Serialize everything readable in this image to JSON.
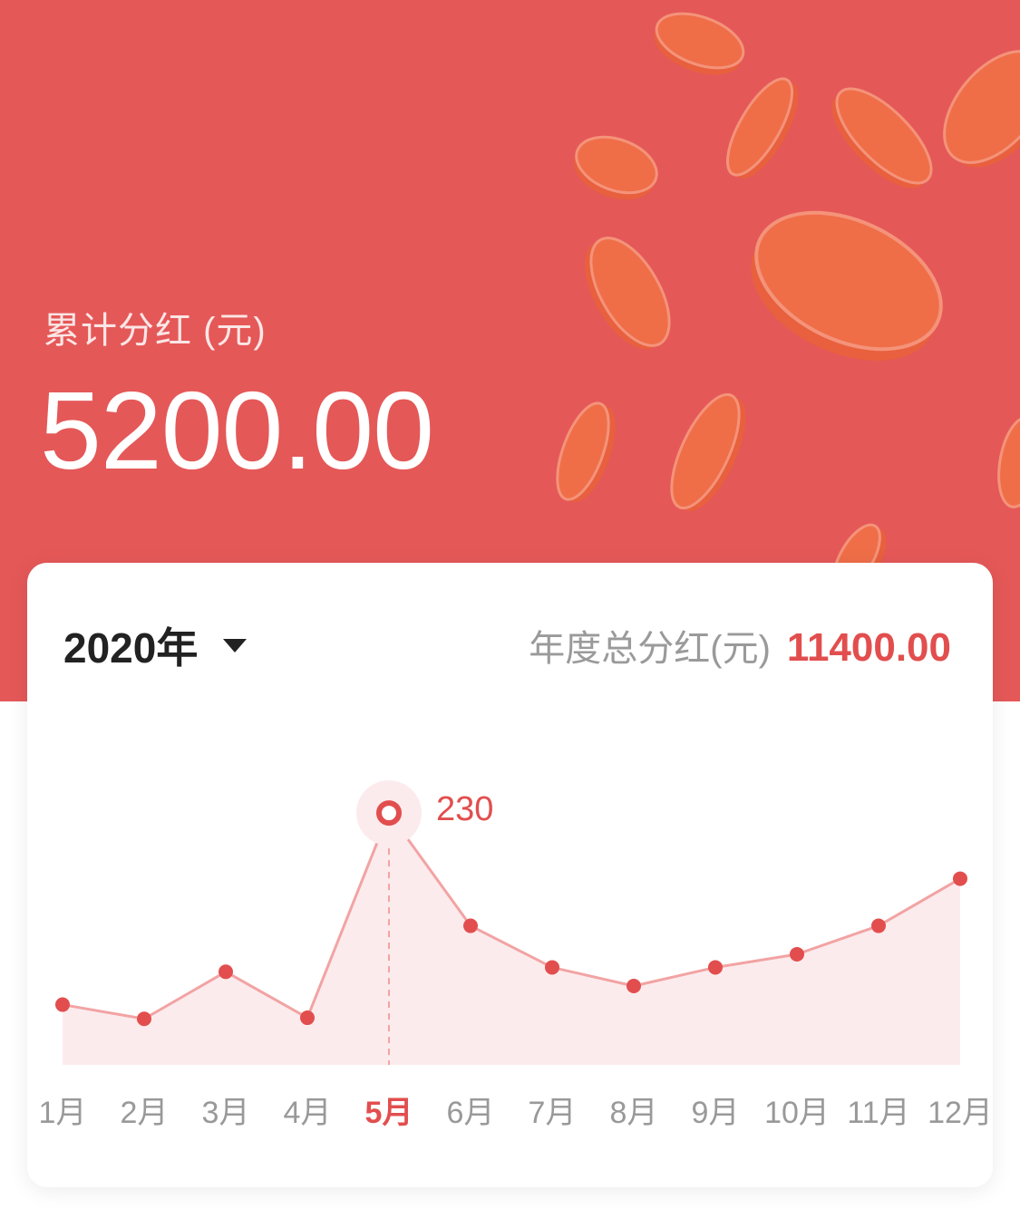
{
  "header": {
    "label": "累计分红 (元)",
    "amount": "5200.00"
  },
  "card": {
    "year": "2020年",
    "annual_label": "年度总分红(元)",
    "annual_value": "11400.00"
  },
  "colors": {
    "hero_bg": "#E55858",
    "accent": "#E24E4E",
    "line": "#F2A3A3",
    "area": "#FCEBED",
    "coin": "#EF6E48"
  },
  "chart_data": {
    "type": "area",
    "categories": [
      "1月",
      "2月",
      "3月",
      "4月",
      "5月",
      "6月",
      "7月",
      "8月",
      "9月",
      "10月",
      "11月",
      "12月"
    ],
    "series": [
      {
        "values": [
          55,
          42,
          85,
          43,
          230,
          127,
          89,
          72,
          89,
          101,
          127,
          170
        ]
      }
    ],
    "selected_index": 4,
    "selected_label": "230",
    "ylim": [
      0,
      240
    ],
    "grid": false,
    "y_axis_visible": false
  }
}
